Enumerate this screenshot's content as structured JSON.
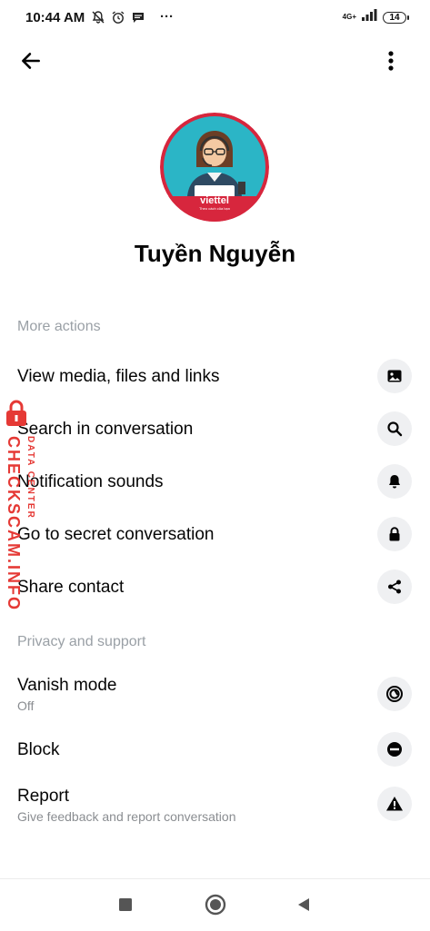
{
  "status_bar": {
    "time": "10:44 AM",
    "more_dots": "···",
    "network_label": "4G+",
    "battery_level": "14",
    "icons": [
      "mute-bell-icon",
      "alarm-icon",
      "message-icon",
      "signal-icon",
      "battery-icon"
    ]
  },
  "header": {
    "back_icon": "arrow-left-icon",
    "more_icon": "vertical-dots-icon"
  },
  "profile": {
    "name": "Tuyền Nguyễn",
    "avatar_brand": "viettel",
    "avatar_tagline": "Theo cách của bạn"
  },
  "more_actions": {
    "title": "More actions",
    "items": [
      {
        "label": "View media, files and links",
        "icon": "image-icon"
      },
      {
        "label": "Search in conversation",
        "icon": "search-icon"
      },
      {
        "label": "Notification sounds",
        "icon": "bell-icon"
      },
      {
        "label": "Go to secret conversation",
        "icon": "lock-icon"
      },
      {
        "label": "Share contact",
        "icon": "share-icon"
      }
    ]
  },
  "privacy_support": {
    "title": "Privacy and support",
    "items": [
      {
        "label": "Vanish mode",
        "sub": "Off",
        "icon": "vanish-icon"
      },
      {
        "label": "Block",
        "sub": "",
        "icon": "block-icon"
      },
      {
        "label": "Report",
        "sub": "Give feedback and report conversation",
        "icon": "warning-icon"
      }
    ]
  },
  "watermark": {
    "main": "CHECKSCAM.INFO",
    "sub": "DATA CENTER"
  },
  "nav_bar": {
    "icons": [
      "recents-square-icon",
      "home-circle-icon",
      "back-triangle-icon"
    ]
  },
  "colors": {
    "accent_red": "#e53935",
    "icon_bg": "#eff0f2",
    "section_gray": "#9aa0a6",
    "avatar_bg": "#2bb5c6",
    "avatar_ring": "#d7263d"
  }
}
